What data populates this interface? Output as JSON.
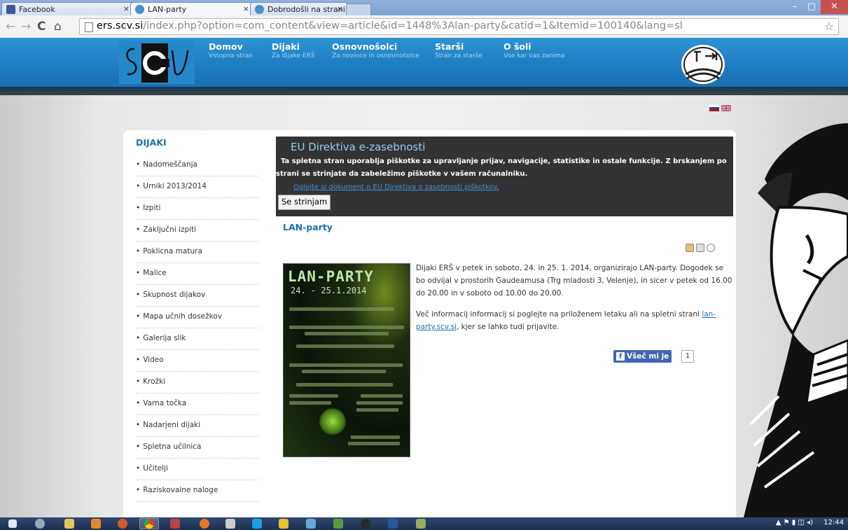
{
  "browser": {
    "tabs": [
      {
        "title": "Facebook"
      },
      {
        "title": "LAN-party"
      },
      {
        "title": "Dobrodošli na strani Elekt"
      }
    ],
    "url_host": "ers.scv.si",
    "url_path": "/index.php?option=com_content&view=article&id=1448%3Alan-party&catid=1&Itemid=100140&lang=sl"
  },
  "site_nav": [
    {
      "title": "Domov",
      "sub": "Vstopna stran"
    },
    {
      "title": "Dijaki",
      "sub": "Za dijake ERŠ"
    },
    {
      "title": "Osnovnošolci",
      "sub": "Za novince in osnovnošolce"
    },
    {
      "title": "Starši",
      "sub": "Stran za starše"
    },
    {
      "title": "O šoli",
      "sub": "Vse kar vas zanima"
    }
  ],
  "sidebar": {
    "title": "DIJAKI",
    "items": [
      "Nadomeščanja",
      "Urniki 2013/2014",
      "Izpiti",
      "Zaključni izpiti",
      "Poklicna matura",
      "Malice",
      "Skupnost dijakov",
      "Mapa učnih dosežkov",
      "Galerija slik",
      "Video",
      "Krožki",
      "Varna točka",
      "Nadarjeni dijaki",
      "Spletna učilnica",
      "Učitelji",
      "Raziskovalne naloge"
    ]
  },
  "cookie": {
    "title": "EU Direktiva e-zasebnosti",
    "text": "Ta spletna stran uporablja piškotke za upravljanje prijav, navigacije, statistike in ostale funkcije. Z brskanjem po strani se strinjate da zabeležimo piškotke v vašem računalniku.",
    "link": "Oglejte si dokument o EU Direktiva o zasebnosti piškotkov.",
    "button": "Se strinjam"
  },
  "article": {
    "title": "LAN-party",
    "p1": "Dijaki ERŠ v petek in soboto, 24. in 25. 1. 2014, organizirajo LAN-party. Dogodek se bo odvijal v prostorih Gaudeamusa (Trg mladosti 3, Velenje), in sicer v petek od 16.00 do 20.00 in v soboto od 10.00 do 20.00.",
    "p2_before": "Več informacij informacij si poglejte na priloženem letaku ali na spletni strani ",
    "p2_link": "lan-party.scv.si",
    "p2_after": ", kjer se lahko tudi prijavite.",
    "like_label": "Všeč mi je",
    "like_count": "1"
  },
  "poster": {
    "title": "LAN-PARTY",
    "date": "24. - 25.1.2014"
  },
  "taskbar": {
    "clock": "12:44"
  }
}
